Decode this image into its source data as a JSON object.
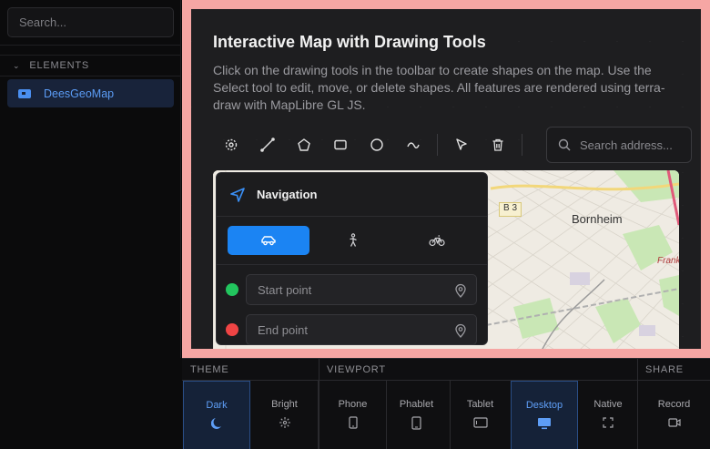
{
  "sidebar": {
    "search_placeholder": "Search...",
    "section_label": "ELEMENTS",
    "items": [
      {
        "label": "DeesGeoMap",
        "active": true
      }
    ]
  },
  "demo": {
    "title": "Interactive Map with Drawing Tools",
    "description": "Click on the drawing tools in the toolbar to create shapes on the map. Use the Select tool to edit, move, or delete shapes. All features are rendered using terra-draw with MapLibre GL JS.",
    "toolbar": {
      "tools": [
        "point-tool-icon",
        "line-tool-icon",
        "polygon-tool-icon",
        "rectangle-tool-icon",
        "circle-tool-icon",
        "freehand-tool-icon",
        "select-tool-icon",
        "delete-tool-icon"
      ],
      "address_placeholder": "Search address..."
    },
    "map": {
      "place_label": "Bornheim",
      "road_label": "B 3",
      "place_label_2": "Frank"
    },
    "navigation": {
      "title": "Navigation",
      "modes": [
        {
          "name": "car",
          "active": true
        },
        {
          "name": "walk",
          "active": false
        },
        {
          "name": "bike",
          "active": false
        }
      ],
      "start_placeholder": "Start point",
      "end_placeholder": "End point",
      "start_color": "#22c55e",
      "end_color": "#ef4444"
    }
  },
  "bottom_bar": {
    "groups": {
      "theme": "THEME",
      "viewport": "VIEWPORT",
      "share": "SHARE"
    },
    "theme_options": [
      {
        "label": "Dark",
        "active": true
      },
      {
        "label": "Bright",
        "active": false
      }
    ],
    "viewport_options": [
      {
        "label": "Phone",
        "active": false
      },
      {
        "label": "Phablet",
        "active": false
      },
      {
        "label": "Tablet",
        "active": false
      },
      {
        "label": "Desktop",
        "active": true
      },
      {
        "label": "Native",
        "active": false
      }
    ],
    "share_options": [
      {
        "label": "Record",
        "active": false
      }
    ]
  },
  "colors": {
    "accent": "#1b84f3",
    "frame": "#f6a6a4",
    "sidebar_active_text": "#5b9cf5"
  }
}
